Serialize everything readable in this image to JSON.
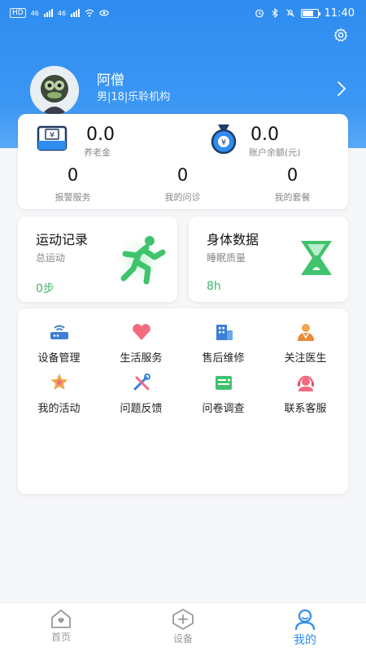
{
  "status_bar": {
    "time": "11:40",
    "sim1": "46",
    "sim2": "46"
  },
  "profile": {
    "name": "阿僧",
    "info": "男|18|乐聆机构"
  },
  "stats": {
    "pension": {
      "value": "0.0",
      "label": "养老金"
    },
    "balance": {
      "value": "0.0",
      "label": "账户余额(元)"
    },
    "items": [
      {
        "value": "0",
        "label": "报警服务"
      },
      {
        "value": "0",
        "label": "我的问诊"
      },
      {
        "value": "0",
        "label": "我的套餐"
      }
    ]
  },
  "features": [
    {
      "title": "运动记录",
      "subtitle": "总运动",
      "value": "0步"
    },
    {
      "title": "身体数据",
      "subtitle": "睡眠质量",
      "value": "8h"
    }
  ],
  "services": [
    {
      "label": "设备管理",
      "icon": "router-icon"
    },
    {
      "label": "生活服务",
      "icon": "heart-icon"
    },
    {
      "label": "售后维修",
      "icon": "building-icon"
    },
    {
      "label": "关注医生",
      "icon": "doctor-icon"
    },
    {
      "label": "我的活动",
      "icon": "star-badge-icon"
    },
    {
      "label": "问题反馈",
      "icon": "tools-icon"
    },
    {
      "label": "问卷调查",
      "icon": "survey-icon"
    },
    {
      "label": "联系客服",
      "icon": "headset-icon"
    }
  ],
  "nav": [
    {
      "label": "首页",
      "icon": "home-icon"
    },
    {
      "label": "设备",
      "icon": "add-device-icon"
    },
    {
      "label": "我的",
      "icon": "profile-icon",
      "active": true
    }
  ],
  "colors": {
    "primary": "#2f8cf0",
    "green": "#3fb36b",
    "white": "#ffffff"
  }
}
